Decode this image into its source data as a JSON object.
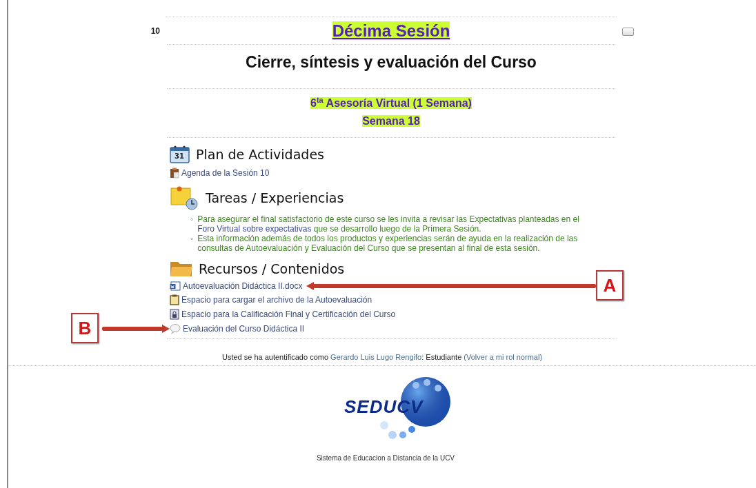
{
  "section": {
    "number": "10",
    "title": "Décima Sesión",
    "subtitle": "Cierre, síntesis y evaluación del Curso",
    "highlights": [
      "6$^{ta}$ Asesoría Virtual (1 Semana)",
      "Semana 18"
    ],
    "blocks": [
      {
        "kind": "heading",
        "text": "Plan de Actividades",
        "icon_label": "31"
      },
      {
        "kind": "link",
        "text": "Agenda de la Sesión 10"
      },
      {
        "kind": "heading",
        "text": "Tareas / Experiencias"
      },
      {
        "kind": "bullets",
        "items": [
          {
            "marker": "◦",
            "before": "Para asegurar el final satisfactorio de este curso se les invita a revisar las Expectativas planteadas en el ",
            "link": "Foro Virtual sobre expectativas",
            "after": " que se desarrollo luego de la Primera Sesión."
          },
          {
            "marker": "◦",
            "before": "Esta información además de todos los productos y experiencias serán de ayuda en la realización de las consultas de Autoevaluación y Evaluación del Curso que se presentan al final de esta sesión."
          }
        ]
      },
      {
        "kind": "heading",
        "text": "Recursos / Contenidos"
      },
      {
        "kind": "link",
        "text": "Autoevaluación Didáctica II.docx"
      },
      {
        "kind": "link",
        "text": "Espacio para cargar el archivo de la Autoevaluación"
      },
      {
        "kind": "link",
        "text": "Espacio para la Calificación Final y Certificación del Curso"
      },
      {
        "kind": "link",
        "text": "Evaluación del Curso Didáctica II"
      }
    ]
  },
  "login_info": {
    "before": "Usted se ha autentificado como ",
    "user": "Gerardo Luis Lugo Rengifo",
    "role": ": Estudiante ",
    "switch_role": "(Volver a mi rol normal)"
  },
  "footer": {
    "logo_text": "SEDUCV",
    "caption": "Sistema de Educacion a Distancia de la UCV"
  },
  "annotations": [
    {
      "label": "A"
    },
    {
      "label": "B"
    }
  ]
}
